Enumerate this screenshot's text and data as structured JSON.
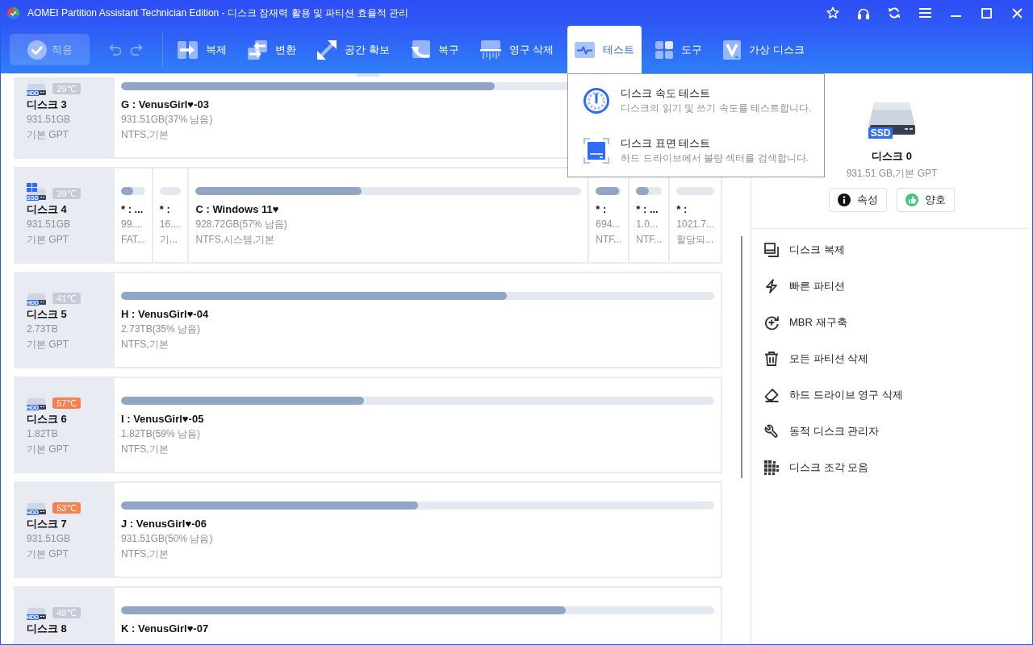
{
  "window": {
    "title": "AOMEI Partition Assistant Technician Edition - 디스크 잠재력 활용 및 파티션 효율적 관리"
  },
  "toolbar": {
    "apply": {
      "label": "적용",
      "disabled": true
    },
    "undo": {
      "disabled": true
    },
    "redo": {
      "disabled": true
    },
    "tools": [
      {
        "label": "복제",
        "selected": false
      },
      {
        "label": "변환",
        "selected": false
      },
      {
        "label": "공간 확보",
        "selected": false
      },
      {
        "label": "복구",
        "selected": false
      },
      {
        "label": "영구 삭제",
        "selected": false
      },
      {
        "label": "테스트",
        "selected": true,
        "menu": [
          {
            "title": "디스크 속도 테스트",
            "description": "디스크의 읽기 및 쓰기 속도를 테스트합니다."
          },
          {
            "title": "디스크 표면 테스트",
            "description": "하드 드라이브에서 불량 섹터를 검색합니다."
          }
        ]
      },
      {
        "label": "도구",
        "selected": false
      },
      {
        "label": "가상 디스크",
        "selected": false
      }
    ]
  },
  "disks": [
    {
      "name": "디스크 3",
      "drive_type": "HDD",
      "system_disk": false,
      "temperature": {
        "text": "29℃",
        "color": "#c4cad7"
      },
      "size": "931.51GB",
      "style": "기본 GPT",
      "partitions": [
        {
          "kind": "wide",
          "name": "G : VenusGirl♥-03",
          "size": "931.51GB(37% 남음)",
          "file_system": "NTFS,기본",
          "level": 0.63
        }
      ]
    },
    {
      "name": "디스크 4",
      "drive_type": "SSD",
      "system_disk": true,
      "temperature": {
        "text": "39℃",
        "color": "#c4cad7"
      },
      "size": "931.51GB",
      "style": "기본 GPT",
      "partitions": [
        {
          "kind": "narrow",
          "name": "* : ...",
          "size": "99....",
          "file_system": "FAT...",
          "level": 0.5
        },
        {
          "kind": "narrow",
          "name": "* :",
          "size": "16....",
          "file_system": "기..."
        },
        {
          "kind": "wide",
          "name": "C : Windows 11♥",
          "size": "928.72GB(57% 남음)",
          "file_system": "NTFS,시스템,기본",
          "level": 0.43
        },
        {
          "kind": "narrow",
          "name": "* :",
          "size": "694...",
          "file_system": "NTF...",
          "level": 0.9
        },
        {
          "kind": "narrow",
          "name": "* : ...",
          "size": "1.0...",
          "file_system": "NTF...",
          "level": 0.5
        },
        {
          "kind": "narrow",
          "name": "* :",
          "size": "1021.7...",
          "file_system": "할당되..."
        }
      ]
    },
    {
      "name": "디스크 5",
      "drive_type": "HDD",
      "system_disk": false,
      "temperature": {
        "text": "41℃",
        "color": "#c4cad7"
      },
      "size": "2.73TB",
      "style": "기본 GPT",
      "partitions": [
        {
          "kind": "wide",
          "name": "H : VenusGirl♥-04",
          "size": "2.73TB(35% 남음)",
          "file_system": "NTFS,기본",
          "level": 0.65
        }
      ]
    },
    {
      "name": "디스크 6",
      "drive_type": "HDD",
      "system_disk": false,
      "temperature": {
        "text": "57℃",
        "color": "#f6814c"
      },
      "size": "1.82TB",
      "style": "기본 GPT",
      "partitions": [
        {
          "kind": "wide",
          "name": "I : VenusGirl♥-05",
          "size": "1.82TB(59% 남음)",
          "file_system": "NTFS,기본",
          "level": 0.41
        }
      ]
    },
    {
      "name": "디스크 7",
      "drive_type": "HDD",
      "system_disk": false,
      "temperature": {
        "text": "53℃",
        "color": "#f6814c"
      },
      "size": "931.51GB",
      "style": "기본 GPT",
      "partitions": [
        {
          "kind": "wide",
          "name": "J : VenusGirl♥-06",
          "size": "931.51GB(50% 남음)",
          "file_system": "NTFS,기본",
          "level": 0.5
        }
      ]
    },
    {
      "name": "디스크 8",
      "drive_type": "HDD",
      "system_disk": false,
      "temperature": {
        "text": "48℃",
        "color": "#c4cad7"
      },
      "partitions": [
        {
          "kind": "wide",
          "name": "K : VenusGirl♥-07",
          "level": 0.75
        }
      ]
    }
  ],
  "disk_details": {
    "drive_type": "SSD",
    "name": "디스크 0",
    "info": "931.51 GB,기본 GPT",
    "buttons": [
      {
        "label": "속성"
      },
      {
        "label": "양호"
      }
    ]
  },
  "actions": [
    {
      "label": "디스크 복제"
    },
    {
      "label": "빠른 파티션"
    },
    {
      "label": "MBR 재구축"
    },
    {
      "label": "모든 파티션 삭제"
    },
    {
      "label": "하드 드라이브 영구 삭제"
    },
    {
      "label": "동적 디스크 관리자"
    },
    {
      "label": "디스크 조각 모음"
    }
  ]
}
